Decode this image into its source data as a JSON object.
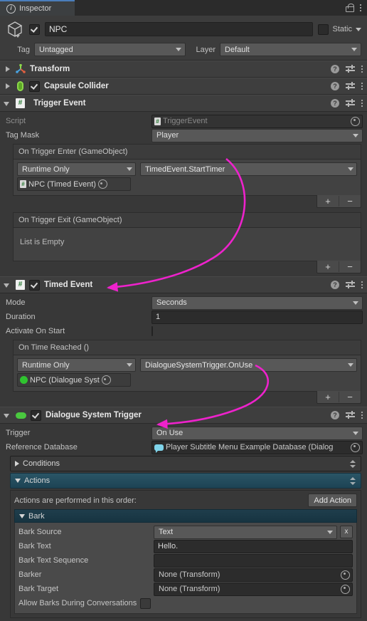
{
  "window": {
    "tab_label": "Inspector",
    "info_icon": "info-icon",
    "lock_icon": "lock-icon",
    "menu_icon": "kebab-menu-icon"
  },
  "object_header": {
    "icon": "cube-icon",
    "enabled": true,
    "name": "NPC",
    "static_label": "Static",
    "static_checked": false,
    "tag_label": "Tag",
    "tag_value": "Untagged",
    "layer_label": "Layer",
    "layer_value": "Default"
  },
  "components": [
    {
      "name": "Transform",
      "icon": "transform-axis-icon",
      "expanded": false,
      "has_checkbox": false
    },
    {
      "name": "Capsule Collider",
      "icon": "capsule-collider-icon",
      "expanded": false,
      "has_checkbox": true,
      "checked": true
    },
    {
      "name": "Trigger Event",
      "icon": "cs-script-icon",
      "expanded": true,
      "has_checkbox": false,
      "rows": [
        {
          "label": "Script",
          "type": "object",
          "value": "TriggerEvent",
          "disabled": true,
          "icon": "cs-script-mini-icon"
        },
        {
          "label": "Tag Mask",
          "type": "dropdown",
          "value": "Player"
        }
      ],
      "events": [
        {
          "title": "On Trigger Enter (GameObject)",
          "empty": false,
          "mode": "Runtime Only",
          "function": "TimedEvent.StartTimer",
          "target": "NPC (Timed Event)",
          "target_icon": "cs-script-mini-icon",
          "add_label": "+",
          "remove_label": "−"
        },
        {
          "title": "On Trigger Exit (GameObject)",
          "empty": true,
          "empty_text": "List is Empty",
          "add_label": "+",
          "remove_label": "−"
        }
      ]
    },
    {
      "name": "Timed Event",
      "icon": "cs-script-icon",
      "expanded": true,
      "has_checkbox": true,
      "checked": true,
      "rows": [
        {
          "label": "Mode",
          "type": "dropdown",
          "value": "Seconds"
        },
        {
          "label": "Duration",
          "type": "text",
          "value": "1"
        },
        {
          "label": "Activate On Start",
          "type": "checkbox",
          "checked": false
        }
      ],
      "events": [
        {
          "title": "On Time Reached ()",
          "empty": false,
          "mode": "Runtime Only",
          "function": "DialogueSystemTrigger.OnUse",
          "target": "NPC (Dialogue Syst",
          "target_icon": "green-dot-icon",
          "add_label": "+",
          "remove_label": "−"
        }
      ]
    },
    {
      "name": "Dialogue System Trigger",
      "icon": "green-pill-icon",
      "expanded": true,
      "has_checkbox": true,
      "checked": true,
      "rows": [
        {
          "label": "Trigger",
          "type": "dropdown",
          "value": "On Use"
        },
        {
          "label": "Reference Database",
          "type": "object",
          "value": "Player Subtitle Menu Example Database (Dialog",
          "icon": "dialogue-bubble-icon"
        }
      ],
      "sections": [
        {
          "label": "Conditions",
          "expanded": false,
          "accent": false
        },
        {
          "label": "Actions",
          "expanded": true,
          "accent": true
        }
      ],
      "actions_panel": {
        "note": "Actions are performed in this order:",
        "add_button": "Add Action",
        "action": {
          "label": "Bark",
          "expanded": true,
          "rows": [
            {
              "label": "Bark Source",
              "type": "dropdown",
              "value": "Text",
              "has_x": true,
              "x_label": "x"
            },
            {
              "label": "Bark Text",
              "type": "text",
              "value": "Hello."
            },
            {
              "label": "Bark Text Sequence",
              "type": "text",
              "value": ""
            },
            {
              "label": "Barker",
              "type": "object",
              "value": "None (Transform)"
            },
            {
              "label": "Bark Target",
              "type": "object",
              "value": "None (Transform)"
            },
            {
              "label": "Allow Barks During Conversations",
              "type": "checkbox",
              "checked": false
            }
          ]
        }
      }
    }
  ],
  "annotations": {
    "arrow_color": "#ee22cc",
    "arrows": [
      {
        "name": "arrow-to-timed-event"
      },
      {
        "name": "arrow-to-dialogue-system-trigger"
      }
    ]
  },
  "icons": {
    "help": "?",
    "add": "+",
    "remove": "−"
  }
}
